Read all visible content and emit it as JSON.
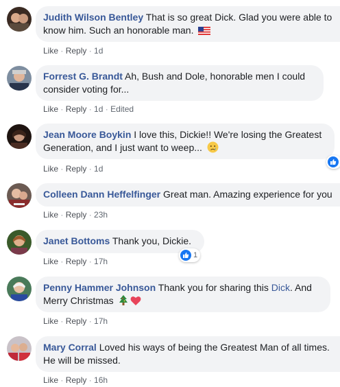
{
  "comments": [
    {
      "name": "Judith Wilson Bentley",
      "text": " That is so great Dick. Glad you were able to",
      "text2": "know him. Such an honorable man.",
      "like": "Like",
      "reply": "Reply",
      "time": "1d",
      "edited": ""
    },
    {
      "name": "Forrest G. Brandt",
      "text": " Ah, Bush and Dole, honorable men I could",
      "text2": "consider voting for...",
      "like": "Like",
      "reply": "Reply",
      "time": "1d",
      "edited": "Edited"
    },
    {
      "name": "Jean Moore Boykin",
      "text": " I love this, Dickie!! We're losing the Greatest",
      "text2": "Generation, and I just want to weep...",
      "like": "Like",
      "reply": "Reply",
      "time": "1d",
      "edited": ""
    },
    {
      "name": "Colleen Dann Heffelfinger",
      "text": " Great man. Amazing experience for you",
      "like": "Like",
      "reply": "Reply",
      "time": "23h",
      "edited": ""
    },
    {
      "name": "Janet Bottoms",
      "text": " Thank you, Dickie.",
      "like": "Like",
      "reply": "Reply",
      "time": "17h",
      "edited": "",
      "reaction_count": "1"
    },
    {
      "name": "Penny Hammer Johnson",
      "text": " Thank you for sharing this ",
      "mention": "Dick",
      "text_after": ". And",
      "text2": "Merry Christmas",
      "like": "Like",
      "reply": "Reply",
      "time": "17h",
      "edited": ""
    },
    {
      "name": "Mary Corral",
      "text": " Loved his ways of being the Greatest Man of all times.",
      "text2": "He will be missed.",
      "like": "Like",
      "reply": "Reply",
      "time": "16h",
      "edited": ""
    }
  ],
  "separator": " · ",
  "icons": {
    "flag": "us-flag-icon",
    "tear": "sad-tear-emoji-icon",
    "tree": "christmas-tree-emoji-icon",
    "heart": "red-heart-emoji-icon",
    "like": "like-reaction-icon"
  },
  "colors": {
    "name_link": "#385898",
    "bubble": "#f2f3f5",
    "meta": "#606770",
    "like_blue": "#1877f2"
  }
}
